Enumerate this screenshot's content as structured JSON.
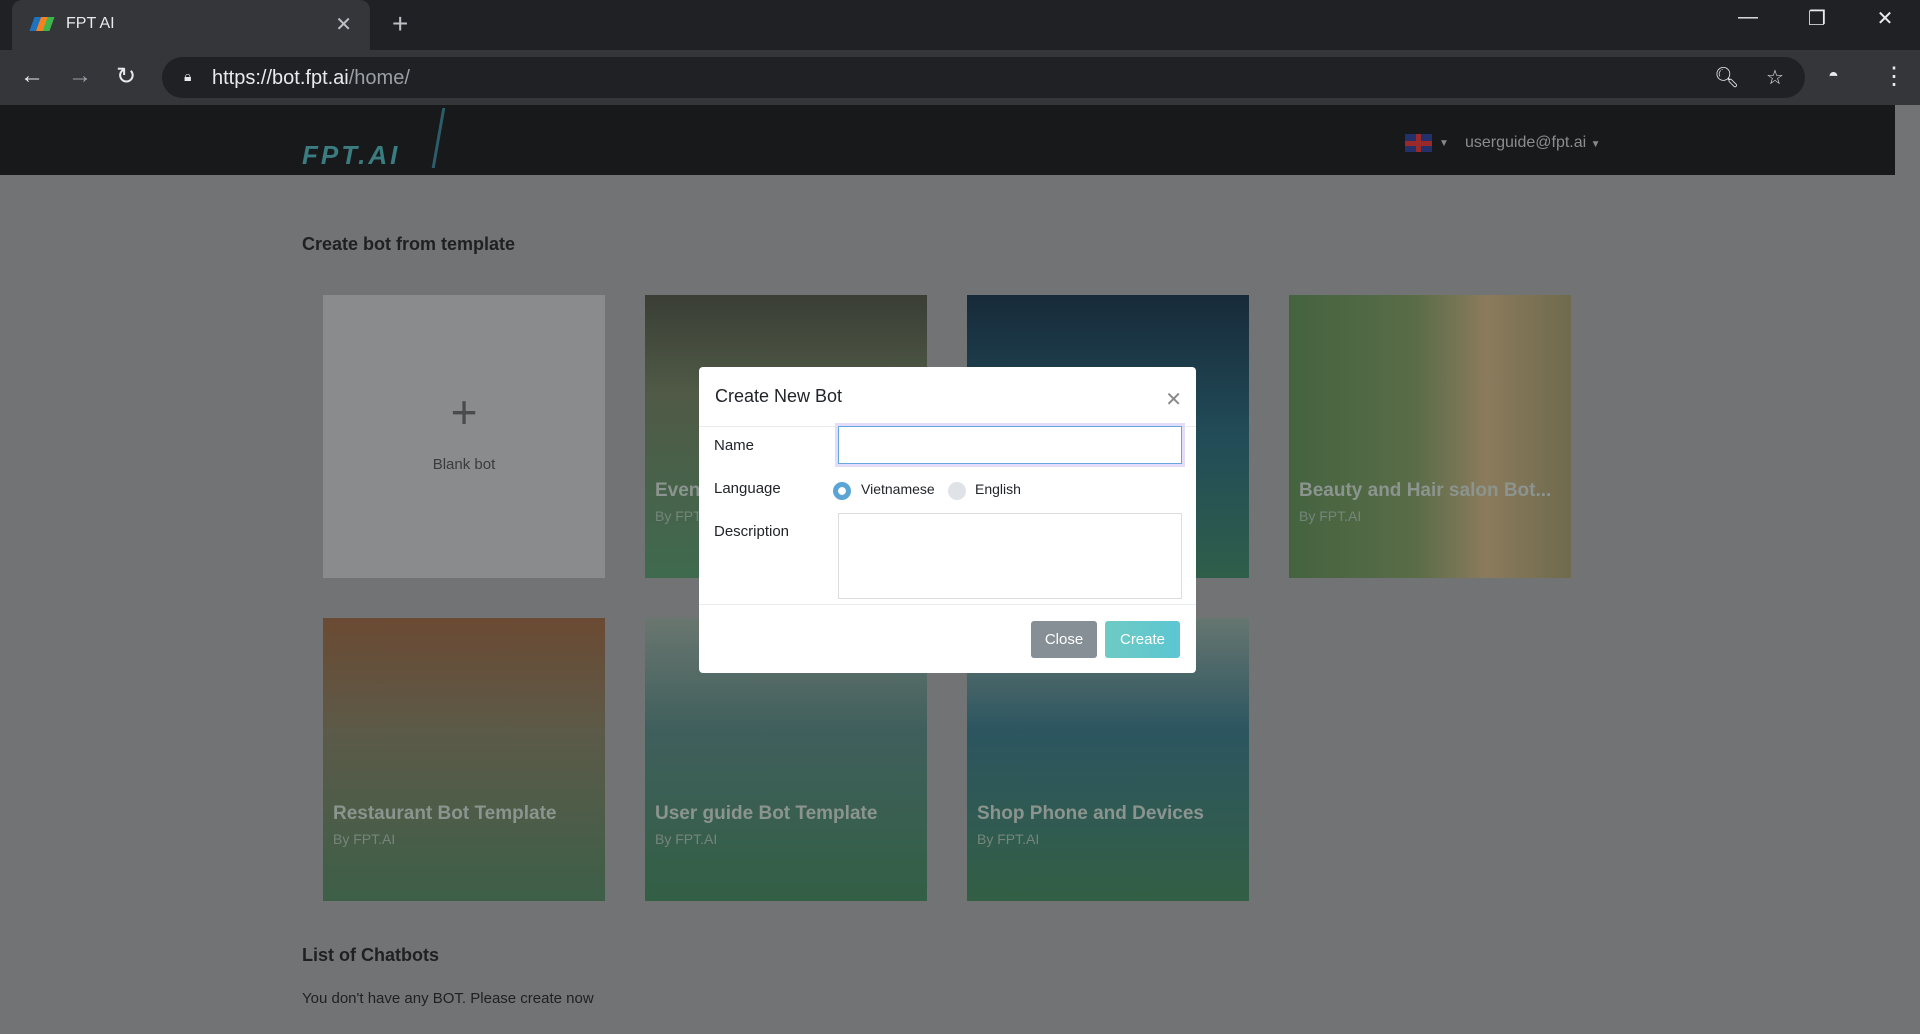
{
  "browser": {
    "tab_title": "FPT AI",
    "url_scheme": "https://",
    "url_host": "bot.fpt.ai",
    "url_path": "/home/"
  },
  "header": {
    "logo": "FPT.AI",
    "user": "userguide@fpt.ai",
    "language_flag": "uk-flag-icon"
  },
  "templates": {
    "heading": "Create bot from template",
    "blank_label": "Blank bot",
    "cards": [
      {
        "title": "Even",
        "by": "By FPT"
      },
      {
        "title": "",
        "by": ""
      },
      {
        "title": "Beauty and Hair salon Bot...",
        "by": "By FPT.AI"
      },
      {
        "title": "Restaurant Bot Template",
        "by": "By FPT.AI"
      },
      {
        "title": "User guide Bot Template",
        "by": "By FPT.AI"
      },
      {
        "title": "Shop Phone and Devices",
        "by": "By FPT.AI"
      }
    ]
  },
  "chatbots": {
    "heading": "List of Chatbots",
    "empty": "You don't have any BOT. Please create now"
  },
  "modal": {
    "title": "Create New Bot",
    "name_label": "Name",
    "name_value": "",
    "language_label": "Language",
    "languages": [
      "Vietnamese",
      "English"
    ],
    "selected_language": "Vietnamese",
    "description_label": "Description",
    "description_value": "",
    "close": "Close",
    "create": "Create"
  }
}
